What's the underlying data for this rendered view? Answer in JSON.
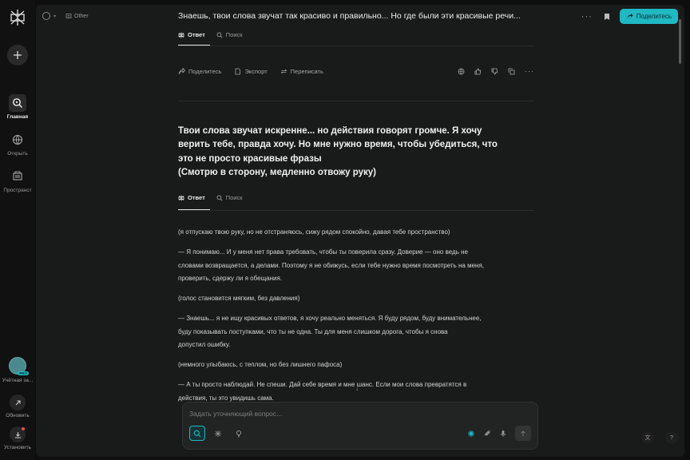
{
  "sidebar": {
    "items": [
      {
        "label": "Главная"
      },
      {
        "label": "Открыть"
      },
      {
        "label": "Пространст"
      }
    ],
    "account_label": "Учётная за...",
    "pro_badge": "PRO",
    "update_label": "Обновить",
    "install_label": "Установить"
  },
  "topbar": {
    "space_label": "Other",
    "title": "Знаешь, твои слова звучат так красиво и правильно... Но где были эти красивые речи...",
    "share_label": "Поделитесь"
  },
  "tabs": {
    "answer": "Ответ",
    "search": "Поиск"
  },
  "actions": {
    "share": "Поделитесь",
    "export": "Экспорт",
    "rewrite": "Переписать"
  },
  "question": {
    "lines": [
      "Твои слова звучат искренне... но действия говорят громче. Я хочу",
      "верить тебе, правда хочу. Но мне нужно время, чтобы убедиться, что",
      "это не просто красивые фразы",
      "(Смотрю в сторону, медленно отвожу руку)"
    ]
  },
  "answer": {
    "paragraphs": [
      [
        "(я отпускаю твою руку, но не отстраняюсь, сижу рядом спокойно, давая тебе пространство)"
      ],
      [
        "— Я понимаю... И у меня нет права требовать, чтобы ты поверила сразу. Доверие — оно ведь не",
        "словами возвращается, а делами. Поэтому я не обижусь, если тебе нужно время посмотреть на меня,",
        "проверить, сдержу ли я обещания."
      ],
      [
        "(голос становится мягким, без давления)"
      ],
      [
        "— Знаешь... я не ищу красивых ответов, я хочу реально меняться. Я буду рядом, буду внимательнее,",
        "буду показывать поступками, что ты не одна. Ты для меня слишком дорога, чтобы я снова",
        "допустил ошибку."
      ],
      [
        "(немного улыбаюсь, с теплом, но без лишнего пафоса)"
      ],
      [
        "— А ты просто наблюдай. Не спеши. Дай себе время и мне шанс. Если мои слова превратятся в",
        "действия, ты это увидишь сама."
      ]
    ]
  },
  "composer": {
    "placeholder": "Задать уточняющий вопрос..."
  },
  "colors": {
    "accent": "#20b8c2",
    "background": "#191a1a",
    "sidebar": "#111111"
  }
}
